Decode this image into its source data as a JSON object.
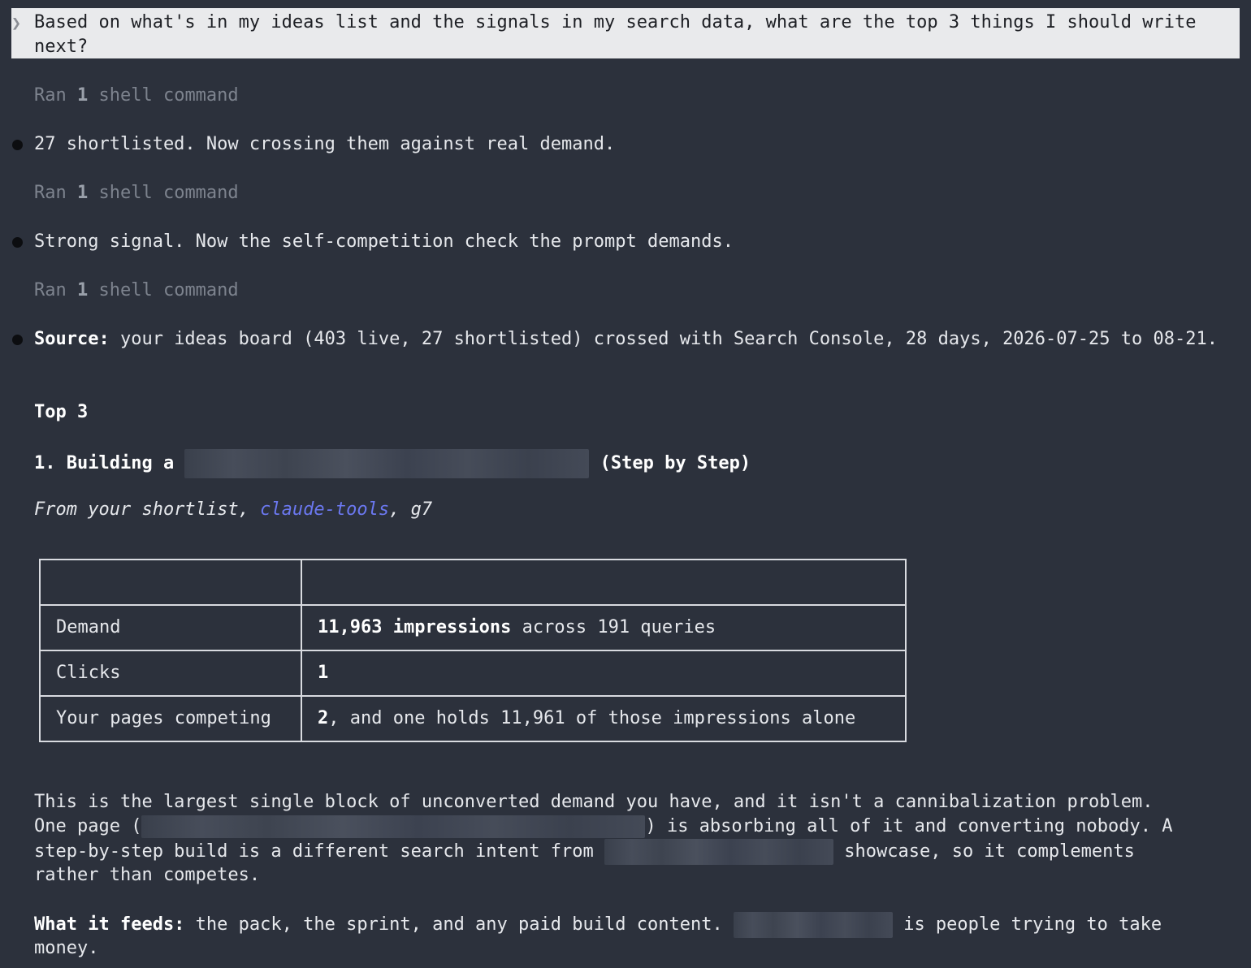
{
  "prompt": {
    "chevron": "❯",
    "text": "Based on what's in my ideas list and the signals in my search data, what are the top 3 things I should write next?"
  },
  "steps": [
    {
      "pre": "Ran ",
      "count": "1",
      "post": " shell command"
    },
    {
      "text": "27 shortlisted. Now crossing them against real demand."
    },
    {
      "pre": "Ran ",
      "count": "1",
      "post": " shell command"
    },
    {
      "text": "Strong signal. Now the self-competition check the prompt demands."
    },
    {
      "pre": "Ran ",
      "count": "1",
      "post": " shell command"
    }
  ],
  "source": {
    "label": "Source:",
    "text": " your ideas board (403 live, 27 shortlisted) crossed with Search Console, 28 days, 2026-07-25 to 08-21."
  },
  "top_heading": "Top 3",
  "item1": {
    "prefix": "1. Building a ",
    "suffix": " (Step by Step)",
    "from_pre": "From your shortlist, ",
    "from_link": "claude-tools",
    "from_post": ", g7"
  },
  "table": {
    "rows": [
      {
        "label": "Demand",
        "value_bold": "11,963 impressions",
        "value_rest": " across 191 queries"
      },
      {
        "label": "Clicks",
        "value_bold": "1",
        "value_rest": ""
      },
      {
        "label": "Your pages competing",
        "value_bold": "2",
        "value_rest": ", and one holds 11,961 of those impressions alone"
      }
    ]
  },
  "paragraph": {
    "line1": "This is the largest single block of unconverted demand you have, and it isn't a cannibalization problem.",
    "line2_pre": "One page (",
    "line2_post": ") is absorbing all of it and converting nobody. A",
    "line3_pre": "step-by-step build is a different search intent from ",
    "line3_post": " showcase, so it complements",
    "line4": "rather than competes."
  },
  "feeds": {
    "label": "What it feeds:",
    "text": " the pack, the sprint, and any paid build content. ",
    "post": " is people trying to take",
    "line2": "money."
  }
}
